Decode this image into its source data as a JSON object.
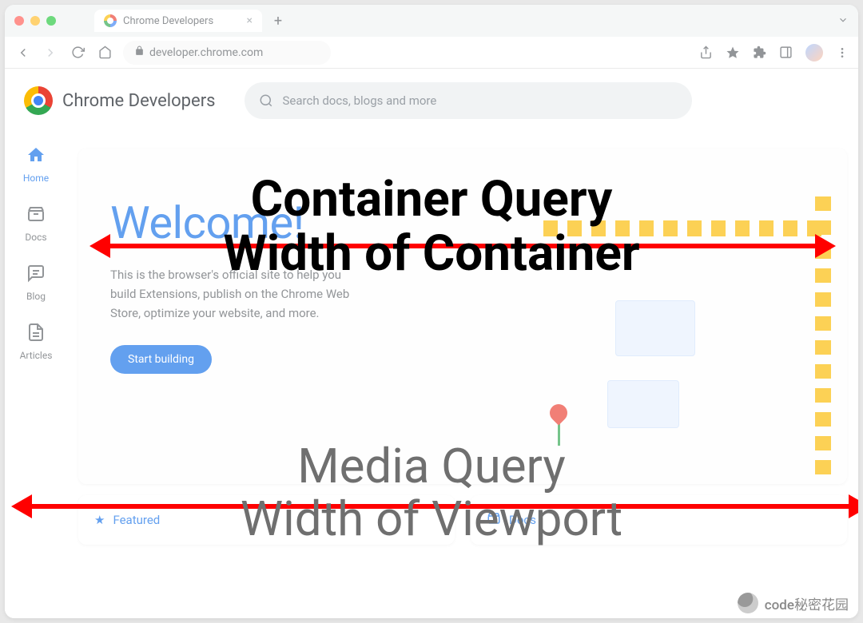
{
  "window": {
    "tab_title": "Chrome Developers",
    "url": "developer.chrome.com"
  },
  "site": {
    "brand": "Chrome Developers",
    "search_placeholder": "Search docs, blogs and more"
  },
  "sidebar": {
    "items": [
      {
        "label": "Home",
        "icon": "home",
        "active": true
      },
      {
        "label": "Docs",
        "icon": "archive",
        "active": false
      },
      {
        "label": "Blog",
        "icon": "chat",
        "active": false
      },
      {
        "label": "Articles",
        "icon": "doc",
        "active": false
      }
    ]
  },
  "hero": {
    "title": "Welcome!",
    "desc_l1": "This is the browser's official site to help you",
    "desc_l2": "build Extensions, publish on the Chrome",
    "desc_l3": "Web Store, optimize your website, and",
    "desc_l4": "more.",
    "cta": "Start building"
  },
  "bottom": {
    "featured_label": "Featured",
    "docs_label": "Docs"
  },
  "overlay": {
    "container_l1": "Container Query",
    "container_l2": "Width of Container",
    "media_l1": "Media Query",
    "media_l2": "Width of Viewport"
  },
  "watermark": {
    "text": "code秘密花园"
  }
}
